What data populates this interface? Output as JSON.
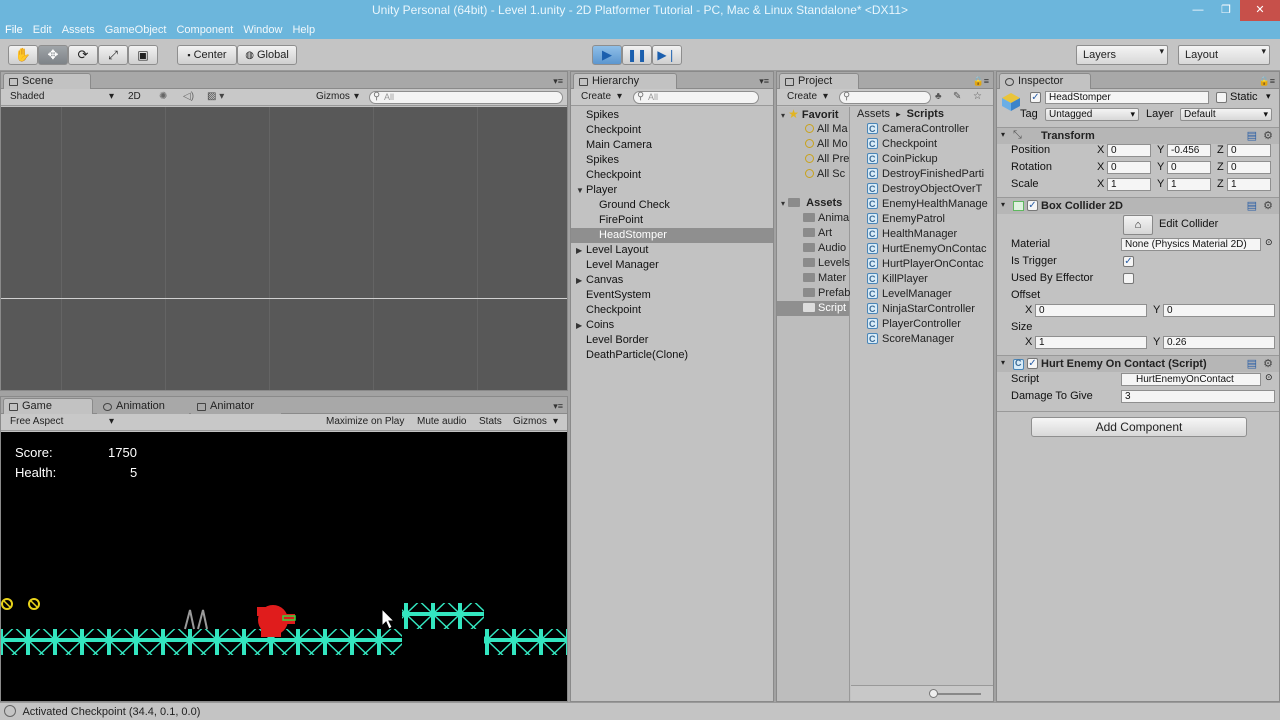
{
  "window": {
    "title": "Unity Personal (64bit) - Level 1.unity - 2D Platformer Tutorial - PC, Mac & Linux Standalone* <DX11>",
    "btn_min": "—",
    "btn_max": "❐",
    "btn_close": "✕"
  },
  "menu": [
    "File",
    "Edit",
    "Assets",
    "GameObject",
    "Component",
    "Window",
    "Help"
  ],
  "toolbar": {
    "pivot_label": "Center",
    "space_label": "Global",
    "layers_label": "Layers",
    "layout_label": "Layout"
  },
  "scene": {
    "tab": "Scene",
    "shading": "Shaded",
    "mode_2d": "2D",
    "gizmos": "Gizmos",
    "search_placeholder": "All"
  },
  "hierarchy": {
    "tab": "Hierarchy",
    "create": "Create",
    "search_placeholder": "All",
    "items": [
      {
        "label": "Spikes",
        "indent": 0,
        "arrow": false,
        "selected": false
      },
      {
        "label": "Checkpoint",
        "indent": 0,
        "arrow": false,
        "selected": false
      },
      {
        "label": "Main Camera",
        "indent": 0,
        "arrow": false,
        "selected": false
      },
      {
        "label": "Spikes",
        "indent": 0,
        "arrow": false,
        "selected": false
      },
      {
        "label": "Checkpoint",
        "indent": 0,
        "arrow": false,
        "selected": false
      },
      {
        "label": "Player",
        "indent": 0,
        "arrow": "down",
        "selected": false
      },
      {
        "label": "Ground Check",
        "indent": 1,
        "arrow": false,
        "selected": false
      },
      {
        "label": "FirePoint",
        "indent": 1,
        "arrow": false,
        "selected": false
      },
      {
        "label": "HeadStomper",
        "indent": 1,
        "arrow": false,
        "selected": true
      },
      {
        "label": "Level Layout",
        "indent": 0,
        "arrow": "right",
        "selected": false
      },
      {
        "label": "Level Manager",
        "indent": 0,
        "arrow": false,
        "selected": false
      },
      {
        "label": "Canvas",
        "indent": 0,
        "arrow": "right",
        "selected": false
      },
      {
        "label": "EventSystem",
        "indent": 0,
        "arrow": false,
        "selected": false
      },
      {
        "label": "Checkpoint",
        "indent": 0,
        "arrow": false,
        "selected": false
      },
      {
        "label": "Coins",
        "indent": 0,
        "arrow": "right",
        "selected": false
      },
      {
        "label": "Level Border",
        "indent": 0,
        "arrow": false,
        "selected": false
      },
      {
        "label": "DeathParticle(Clone)",
        "indent": 0,
        "arrow": false,
        "selected": false
      }
    ]
  },
  "project": {
    "tab": "Project",
    "create": "Create",
    "favorites_label": "Favorit",
    "favorites": [
      "All Ma",
      "All Mo",
      "All Pre",
      "All Sc"
    ],
    "assets_label": "Assets",
    "folders": [
      "Anima",
      "Art",
      "Audio",
      "Levels",
      "Mater",
      "Prefab",
      "Script"
    ],
    "breadcrumb_root": "Assets",
    "breadcrumb_sep": "▸",
    "breadcrumb_current": "Scripts",
    "scripts": [
      "CameraController",
      "Checkpoint",
      "CoinPickup",
      "DestroyFinishedParti",
      "DestroyObjectOverT",
      "EnemyHealthManage",
      "EnemyPatrol",
      "HealthManager",
      "HurtEnemyOnContac",
      "HurtPlayerOnContac",
      "KillPlayer",
      "LevelManager",
      "NinjaStarController",
      "PlayerController",
      "ScoreManager"
    ]
  },
  "inspector": {
    "tab": "Inspector",
    "object_name": "HeadStomper",
    "static_label": "Static",
    "tag_label": "Tag",
    "tag_value": "Untagged",
    "layer_label": "Layer",
    "layer_value": "Default",
    "transform": {
      "title": "Transform",
      "position_label": "Position",
      "rotation_label": "Rotation",
      "scale_label": "Scale",
      "x": "X",
      "y": "Y",
      "z": "Z",
      "position": [
        "0",
        "-0.456",
        "0"
      ],
      "rotation": [
        "0",
        "0",
        "0"
      ],
      "scale": [
        "1",
        "1",
        "1"
      ]
    },
    "box_collider": {
      "title": "Box Collider 2D",
      "edit_collider": "Edit Collider",
      "material_label": "Material",
      "material_value": "None (Physics Material 2D)",
      "is_trigger_label": "Is Trigger",
      "used_by_effector_label": "Used By Effector",
      "offset_label": "Offset",
      "offset": [
        "0",
        "0"
      ],
      "size_label": "Size",
      "size": [
        "1",
        "0.26"
      ]
    },
    "hurt_enemy": {
      "title": "Hurt Enemy On Contact (Script)",
      "script_label": "Script",
      "script_value": "HurtEnemyOnContact",
      "damage_label": "Damage To Give",
      "damage_value": "3"
    },
    "add_component": "Add Component"
  },
  "game": {
    "tab_game": "Game",
    "tab_animation": "Animation",
    "tab_animator": "Animator",
    "aspect": "Free Aspect",
    "maximize": "Maximize on Play",
    "mute": "Mute audio",
    "stats": "Stats",
    "gizmos": "Gizmos",
    "score_label": "Score:",
    "score_value": "1750",
    "health_label": "Health:",
    "health_value": "5"
  },
  "status": {
    "message": "Activated Checkpoint (34.4, 0.1, 0.0)"
  },
  "colors": {
    "accent": "#6cb6dc",
    "platform": "#33e6c0",
    "player": "#e01c1c",
    "coin": "#e8d21a"
  }
}
